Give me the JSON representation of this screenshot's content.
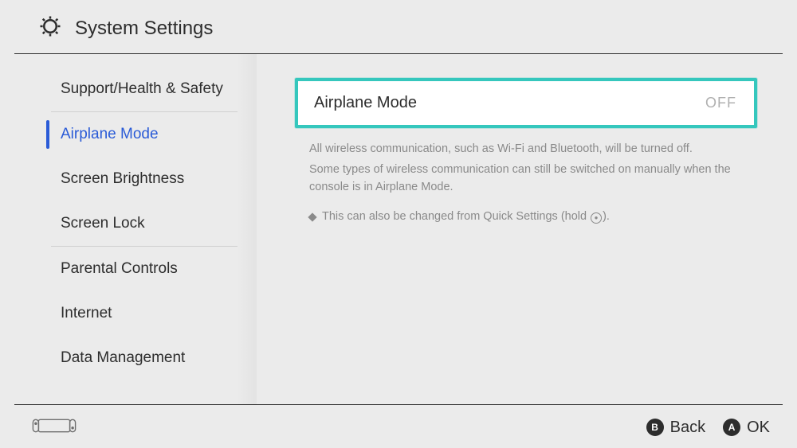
{
  "header": {
    "title": "System Settings"
  },
  "sidebar": {
    "groups": [
      {
        "items": [
          {
            "label": "Support/Health & Safety"
          }
        ]
      },
      {
        "items": [
          {
            "label": "Airplane Mode",
            "selected": true
          },
          {
            "label": "Screen Brightness"
          },
          {
            "label": "Screen Lock"
          }
        ]
      },
      {
        "items": [
          {
            "label": "Parental Controls"
          },
          {
            "label": "Internet"
          },
          {
            "label": "Data Management"
          }
        ]
      }
    ]
  },
  "content": {
    "setting": {
      "label": "Airplane Mode",
      "value": "OFF"
    },
    "description": {
      "line1": "All wireless communication, such as Wi-Fi and Bluetooth, will be turned off.",
      "line2": "Some types of wireless communication can still be switched on manually when the console is in Airplane Mode."
    },
    "note": {
      "prefix": "This can also be changed from Quick Settings (hold ",
      "button_glyph": "⊕",
      "suffix": ")."
    }
  },
  "footer": {
    "actions": [
      {
        "button": "B",
        "label": "Back"
      },
      {
        "button": "A",
        "label": "OK"
      }
    ]
  }
}
